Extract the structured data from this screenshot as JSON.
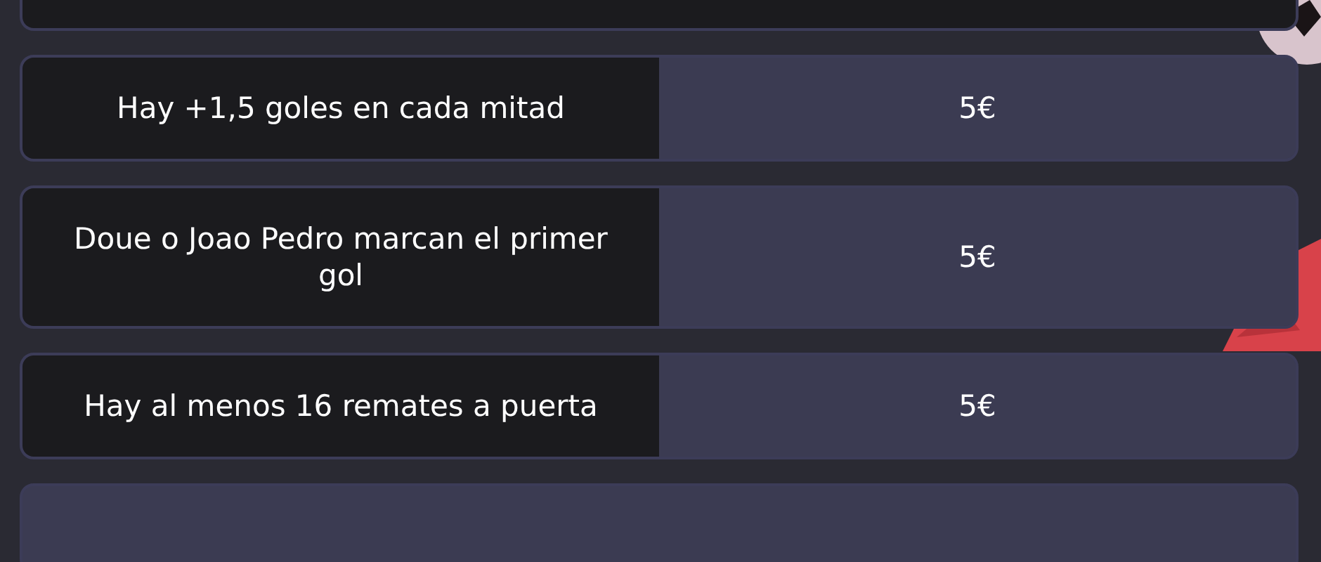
{
  "bets": [
    {
      "question": "Hay +1,5 goles en cada mitad",
      "stake": "5€"
    },
    {
      "question": "Doue o Joao Pedro marcan el primer gol",
      "stake": "5€"
    },
    {
      "question": "Hay al menos 16 remates a puerta",
      "stake": "5€"
    }
  ]
}
